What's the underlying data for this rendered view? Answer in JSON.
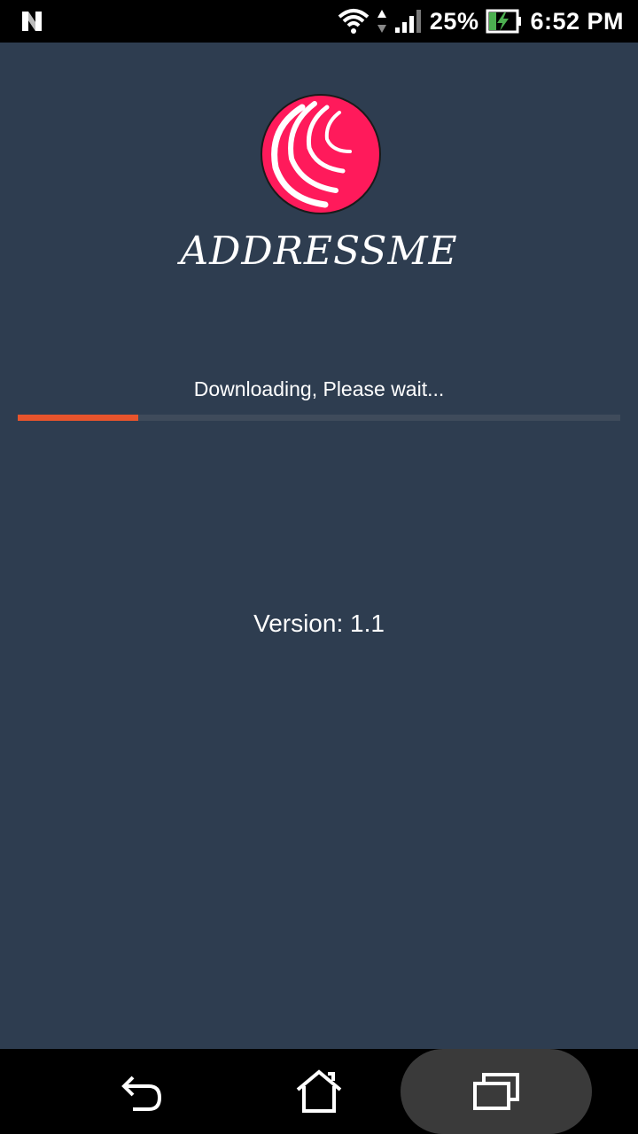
{
  "status_bar": {
    "battery_percent": "25%",
    "time": "6:52 PM",
    "icons": [
      "n-notification-icon",
      "wifi-icon",
      "data-arrows-icon",
      "signal-icon",
      "battery-charging-icon"
    ]
  },
  "app": {
    "logo_icon": "app-logo-icon",
    "name": "ADDRESSME"
  },
  "loading": {
    "message": "Downloading, Please wait...",
    "progress_fraction": 0.2,
    "progress_color": "#e8542c",
    "track_color": "#3f4b5b"
  },
  "version": {
    "text": "Version: 1.1"
  },
  "theme": {
    "background": "#2e3d50",
    "logo_color": "#ff1a5b"
  },
  "nav_bar": {
    "icons": [
      "back-icon",
      "home-icon",
      "recent-apps-icon"
    ]
  }
}
